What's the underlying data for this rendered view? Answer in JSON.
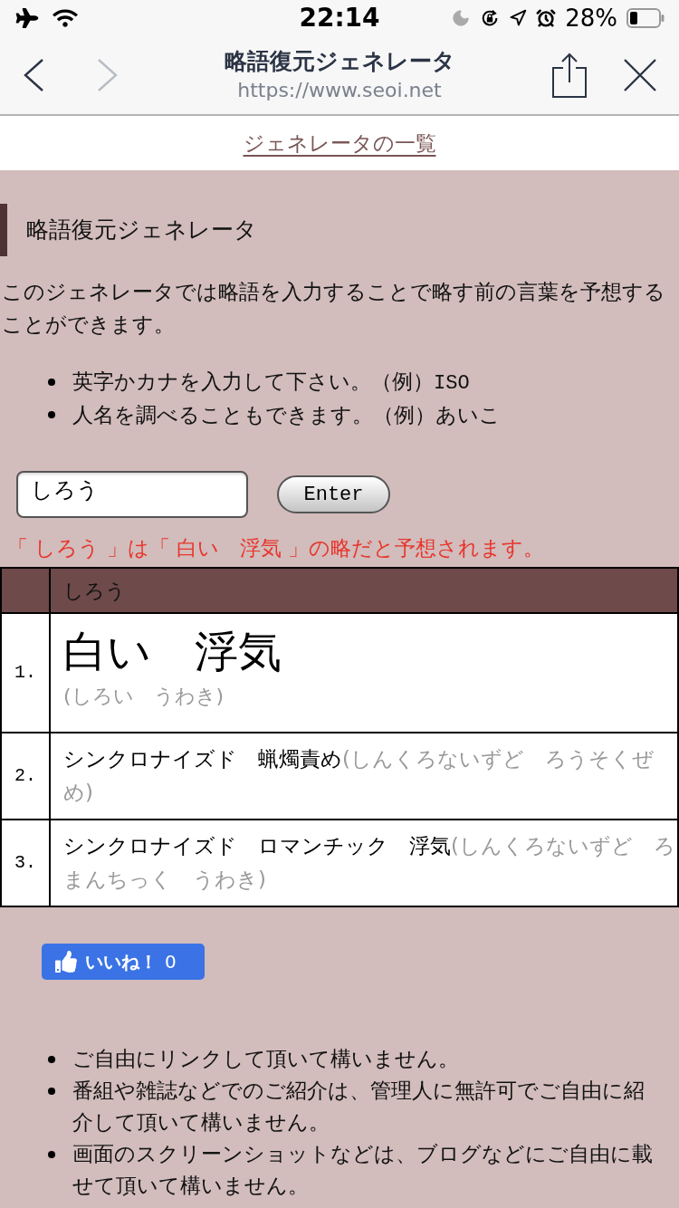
{
  "status_bar": {
    "time": "22:14",
    "battery": "28%"
  },
  "browser": {
    "title": "略語復元ジェネレータ",
    "url": "https://www.seoi.net",
    "nav_buttons": [
      {
        "kind": "back",
        "disabled": false
      },
      {
        "kind": "forward",
        "disabled": true
      }
    ]
  },
  "top_link": "ジェネレータの一覧",
  "heading": "略語復元ジェネレータ",
  "intro": "このジェネレータでは略語を入力することで略す前の言葉を予想することができます。",
  "hints": [
    {
      "text": "英字かカナを入力して下さい。（例）",
      "code": "ISO"
    },
    {
      "text": "人名を調べることもできます。（例）あいこ"
    }
  ],
  "form": {
    "input": {
      "value": "しろう"
    },
    "button": "Enter"
  },
  "result_message": "「 しろう 」は「 白い　浮気 」の略だと予想されます。",
  "table": {
    "column_2": "しろう",
    "rows": [
      {
        "number": "1.",
        "kind": "featured",
        "phrase": "白い　浮気",
        "reading": "(しろい　うわき)"
      },
      {
        "number": "2.",
        "kind": "plain",
        "phrase": "シンクロナイズド　蝋燭責め",
        "reading": "(しんくろないずど　ろうそくぜめ)"
      },
      {
        "number": "3.",
        "kind": "plain",
        "phrase": "シンクロナイズド　ロマンチック　浮気",
        "reading": "(しんくろないずど　ろまんちっく　うわき)"
      }
    ]
  },
  "like_button": {
    "label": "いいね！",
    "count": "0"
  },
  "notes": [
    "ご自由にリンクして頂いて構いません。",
    "番組や雑誌などでのご紹介は、管理人に無許可でご自由に紹介して頂いて構いません。",
    "画面のスクリーンショットなどは、ブログなどにご自由に載せて頂いて構いません。"
  ]
}
